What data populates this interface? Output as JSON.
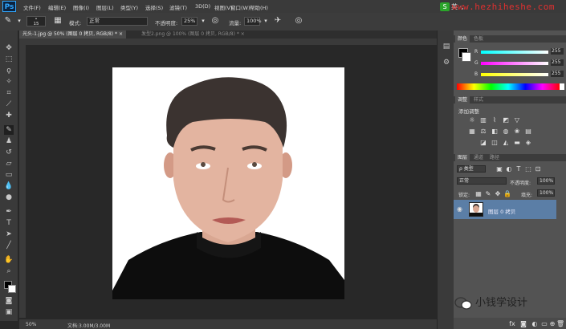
{
  "menubar": {
    "logo": "Ps",
    "items": [
      "文件(F)",
      "编辑(E)",
      "图像(I)",
      "图层(L)",
      "类型(Y)",
      "选择(S)",
      "滤镜(T)",
      "3D(D)",
      "视图(V)",
      "窗口(W)",
      "帮助(H)"
    ],
    "watermark": "www.hezhiheshe.com",
    "ime_badge": "S",
    "ime_text": "英 ·,"
  },
  "options": {
    "brush_size": "15",
    "mode_label": "模式:",
    "mode_value": "正常",
    "opacity_label": "不透明度:",
    "opacity_value": "25%",
    "flow_label": "流量:",
    "flow_value": "100%"
  },
  "tabs": {
    "active": "光头-1.jpg @ 50% (图层 0 拷贝, RGB/8) *",
    "inactive": "发型2.png @ 100% (图层 0 拷贝, RGB/8) *"
  },
  "status": {
    "zoom": "50%",
    "doc": "文档:3.00M/3.00M"
  },
  "color_panel": {
    "tabs": [
      "颜色",
      "色板"
    ],
    "r_label": "R",
    "r_value": "255",
    "g_label": "G",
    "g_value": "255",
    "b_label": "B",
    "b_value": "255"
  },
  "adjust_panel": {
    "tabs": [
      "调整",
      "样式"
    ],
    "title": "添加调整"
  },
  "layers_panel": {
    "tabs": [
      "图层",
      "通道",
      "路径"
    ],
    "kind_label": "ρ 类型",
    "blend_mode": "正常",
    "opacity_label": "不透明度:",
    "opacity_value": "100%",
    "lock_label": "锁定:",
    "fill_label": "填充:",
    "fill_value": "100%",
    "layer_name": "图层 0 拷贝"
  },
  "footer_brand": "小钱学设计",
  "colors": {
    "accent": "#31a8ff",
    "selected_layer": "#5b7ea6",
    "watermark": "#e03030"
  }
}
